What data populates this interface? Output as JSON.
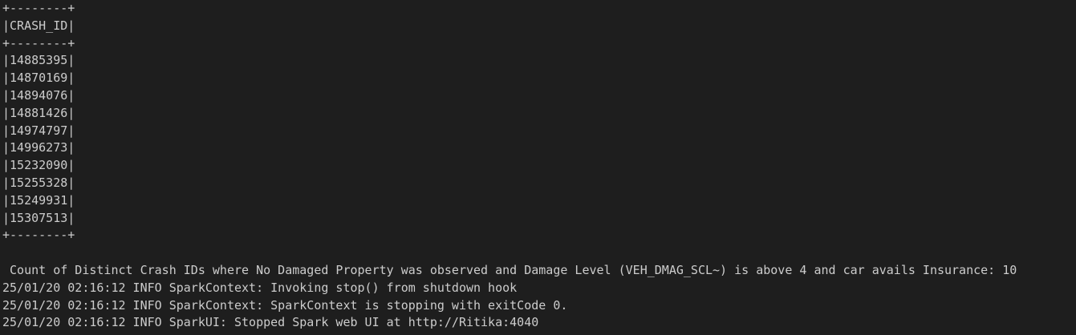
{
  "terminal": {
    "table": {
      "border": "+--------+",
      "header": "|CRASH_ID|",
      "rows": [
        "|14885395|",
        "|14870169|",
        "|14894076|",
        "|14881426|",
        "|14974797|",
        "|14996273|",
        "|15232090|",
        "|15255328|",
        "|15249931|",
        "|15307513|"
      ]
    },
    "summary": " Count of Distinct Crash IDs where No Damaged Property was observed and Damage Level (VEH_DMAG_SCL~) is above 4 and car avails Insurance: 10",
    "logs": [
      "25/01/20 02:16:12 INFO SparkContext: Invoking stop() from shutdown hook",
      "25/01/20 02:16:12 INFO SparkContext: SparkContext is stopping with exitCode 0.",
      "25/01/20 02:16:12 INFO SparkUI: Stopped Spark web UI at http://Ritika:4040"
    ],
    "colors": {
      "background": "#1e1e1e",
      "text": "#cccccc"
    }
  }
}
